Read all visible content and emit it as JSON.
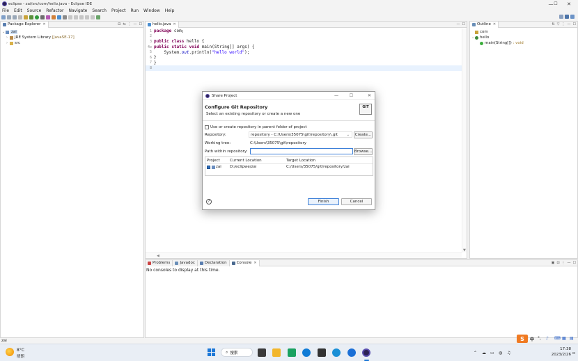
{
  "window": {
    "title": "eclipse - zai/src/com/hello.java - Eclipse IDE",
    "controls": {
      "minimize": "—",
      "maximize": "☐",
      "close": "✕"
    }
  },
  "menu": [
    "File",
    "Edit",
    "Source",
    "Refactor",
    "Navigate",
    "Search",
    "Project",
    "Run",
    "Window",
    "Help"
  ],
  "package_explorer": {
    "tab": "Package Explorer",
    "tree": [
      {
        "label": "zai",
        "level": 0,
        "expanded": true
      },
      {
        "label": "JRE System Library",
        "suffix": "[JavaSE-17]",
        "level": 1
      },
      {
        "label": "src",
        "level": 1
      }
    ]
  },
  "editor": {
    "tab": "hello.java",
    "lines": [
      {
        "n": "1",
        "tokens": [
          {
            "t": "package",
            "c": "kw"
          },
          {
            "t": " com;",
            "c": ""
          }
        ]
      },
      {
        "n": "2",
        "tokens": []
      },
      {
        "n": "3",
        "tokens": [
          {
            "t": "public",
            "c": "kw"
          },
          {
            "t": " ",
            "c": ""
          },
          {
            "t": "class",
            "c": "kw"
          },
          {
            "t": " hello {",
            "c": ""
          }
        ]
      },
      {
        "n": "4⊖",
        "tokens": [
          {
            "t": "public",
            "c": "kw"
          },
          {
            "t": " ",
            "c": ""
          },
          {
            "t": "static",
            "c": "kw"
          },
          {
            "t": " ",
            "c": ""
          },
          {
            "t": "void",
            "c": "kw"
          },
          {
            "t": " main(String[] args) {",
            "c": ""
          }
        ]
      },
      {
        "n": "5",
        "tokens": [
          {
            "t": "    System.",
            "c": ""
          },
          {
            "t": "out",
            "c": "fld"
          },
          {
            "t": ".println(",
            "c": ""
          },
          {
            "t": "\"hello world\"",
            "c": "str"
          },
          {
            "t": ");",
            "c": ""
          }
        ]
      },
      {
        "n": "6",
        "tokens": [
          {
            "t": "}",
            "c": ""
          }
        ]
      },
      {
        "n": "7",
        "tokens": [
          {
            "t": "}",
            "c": ""
          }
        ]
      },
      {
        "n": "8",
        "tokens": [],
        "current": true
      }
    ]
  },
  "outline": {
    "tab": "Outline",
    "items": [
      {
        "label": "com",
        "level": 0
      },
      {
        "label": "hello",
        "level": 0
      },
      {
        "label": "main(String[])",
        "suffix": ": void",
        "level": 1
      }
    ]
  },
  "bottom_panel": {
    "tabs": [
      "Problems",
      "Javadoc",
      "Declaration",
      "Console"
    ],
    "message": "No consoles to display at this time."
  },
  "dialog": {
    "title": "Share Project",
    "heading": "Configure Git Repository",
    "subheading": "Select an existing repository or create a new one",
    "badge": "GIT",
    "checkbox_label": "Use or create repository in parent folder of project",
    "repository_label": "Repository:",
    "repository_value": "repository - C:\\Users\\35075\\git\\repository\\.git",
    "create_label": "Create...",
    "working_tree_label": "Working tree:",
    "working_tree_value": "C:\\Users\\35075\\git\\repository",
    "path_label": "Path within repository:",
    "path_value": "",
    "browse_label": "Browse...",
    "table": {
      "headers": [
        "Project",
        "Current Location",
        "Target Location"
      ],
      "rows": [
        [
          "zai",
          "D:/eclipwe/zai",
          "C:/Users/35075/git/repository/zai"
        ]
      ]
    },
    "help_icon": "?",
    "finish_label": "Finish",
    "cancel_label": "Cancel"
  },
  "statusbar": {
    "text": "zai"
  },
  "taskbar": {
    "weather_temp": "8°C",
    "weather_desc": "晴朗",
    "search_label": "搜索",
    "ime_label": "中",
    "time": "17:38",
    "date": "2023/2/26"
  }
}
